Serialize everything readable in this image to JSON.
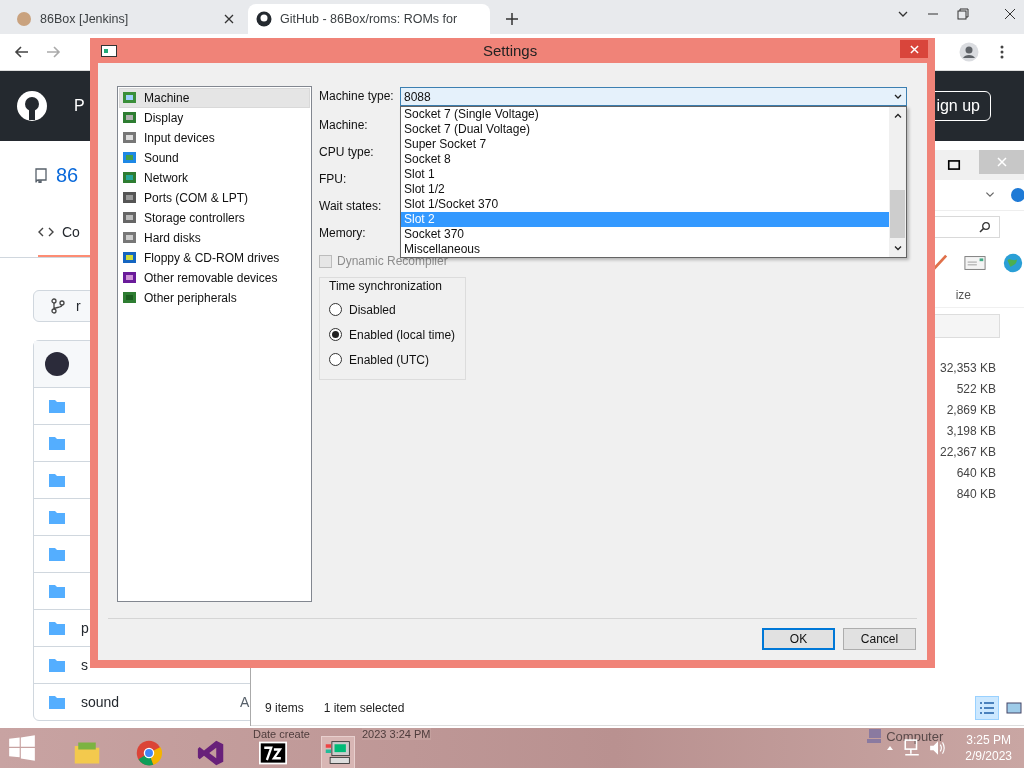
{
  "browser": {
    "tabs": [
      {
        "label": "86Box [Jenkins]",
        "selected": false
      },
      {
        "label": "GitHub - 86Box/roms: ROMs for",
        "selected": true
      }
    ],
    "header_menu": "P",
    "signup_button": "ign up",
    "repo_name": "86",
    "repo_tab": "Co",
    "branch_button": "r",
    "file_rows": [
      {
        "kind": "commit"
      },
      {
        "kind": "folder"
      },
      {
        "kind": "folder"
      },
      {
        "kind": "folder"
      },
      {
        "kind": "folder"
      },
      {
        "kind": "folder"
      },
      {
        "kind": "folder"
      },
      {
        "kind": "folder",
        "name": "p"
      },
      {
        "kind": "folder",
        "name": "s"
      },
      {
        "kind": "folder",
        "name": "sound",
        "column_2": "A"
      }
    ]
  },
  "explorer": {
    "size_column": "ize",
    "sizes": [
      "32,353 KB",
      "522 KB",
      "2,869 KB",
      "3,198 KB",
      "22,367 KB",
      "640 KB",
      "840 KB"
    ],
    "status": [
      "9 items",
      "1 item selected"
    ],
    "details": [
      "Date create",
      "2023 3:24 PM"
    ],
    "details_computer": "Computer"
  },
  "settings": {
    "title": "Settings",
    "categories": [
      {
        "label": "Machine",
        "selected": true
      },
      {
        "label": "Display",
        "selected": false
      },
      {
        "label": "Input devices",
        "selected": false
      },
      {
        "label": "Sound",
        "selected": false
      },
      {
        "label": "Network",
        "selected": false
      },
      {
        "label": "Ports (COM & LPT)",
        "selected": false
      },
      {
        "label": "Storage controllers",
        "selected": false
      },
      {
        "label": "Hard disks",
        "selected": false
      },
      {
        "label": "Floppy & CD-ROM drives",
        "selected": false
      },
      {
        "label": "Other removable devices",
        "selected": false
      },
      {
        "label": "Other peripherals",
        "selected": false
      }
    ],
    "machine_type": {
      "label": "Machine type:",
      "value": "8088"
    },
    "field_labels": [
      "Machine:",
      "CPU type:",
      "FPU:",
      "Wait states:",
      "Memory:"
    ],
    "machine_type_options": [
      {
        "label": "Socket 7 (Single Voltage)",
        "selected": false
      },
      {
        "label": "Socket 7 (Dual Voltage)",
        "selected": false
      },
      {
        "label": "Super Socket 7",
        "selected": false
      },
      {
        "label": "Socket 8",
        "selected": false
      },
      {
        "label": "Slot 1",
        "selected": false
      },
      {
        "label": "Slot 1/2",
        "selected": false
      },
      {
        "label": "Slot 1/Socket 370",
        "selected": false
      },
      {
        "label": "Slot 2",
        "selected": true
      },
      {
        "label": "Socket 370",
        "selected": false
      },
      {
        "label": "Miscellaneous",
        "selected": false
      }
    ],
    "dynamic_recompiler": {
      "label": "Dynamic Recompiler",
      "checked": false,
      "disabled": true
    },
    "time_sync": {
      "title": "Time synchronization",
      "options": [
        {
          "label": "Disabled",
          "selected": false
        },
        {
          "label": "Enabled (local time)",
          "selected": true
        },
        {
          "label": "Enabled (UTC)",
          "selected": false
        }
      ]
    },
    "buttons": [
      {
        "label": "OK",
        "default": true
      },
      {
        "label": "Cancel",
        "default": false
      }
    ]
  },
  "taskbar": {
    "time": "3:25 PM",
    "date": "2/9/2023"
  }
}
